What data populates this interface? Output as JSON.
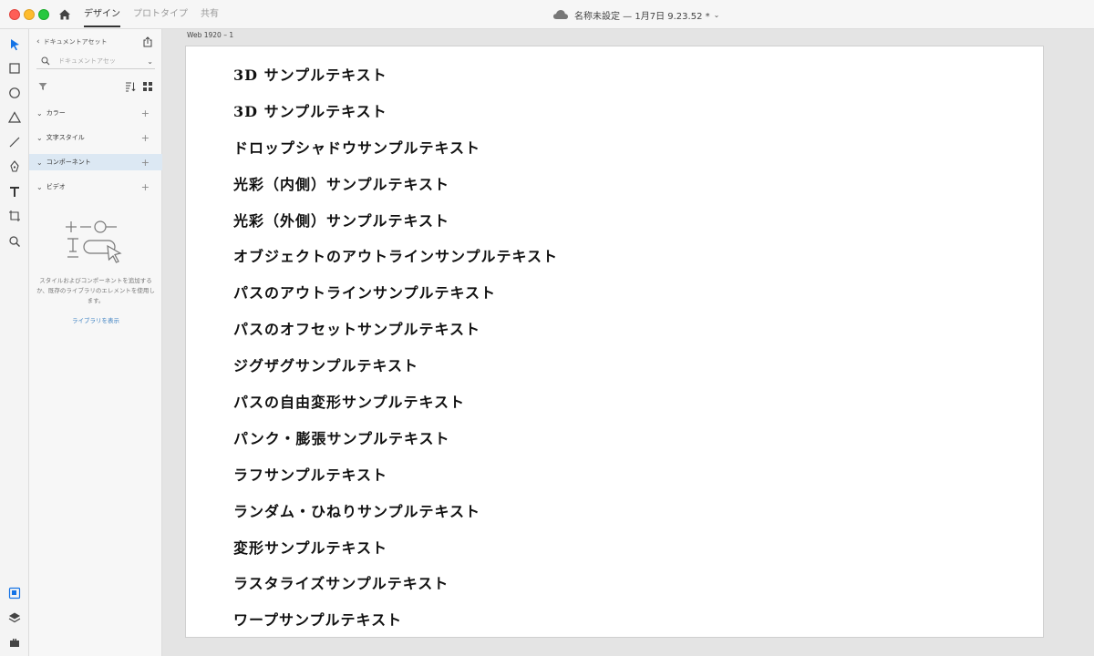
{
  "titlebar": {
    "tabs": [
      "デザイン",
      "プロトタイプ",
      "共有"
    ],
    "active_tab": 0,
    "document_title": "名称未設定 — 1月7日 9.23.52 *"
  },
  "assets_panel": {
    "header": "ドキュメントアセット",
    "search_placeholder": "ドキュメントアセッ",
    "sections": [
      "カラー",
      "文字スタイル",
      "コンポーネント",
      "ビデオ"
    ],
    "selected_section": 2,
    "empty_message": "スタイルおよびコンポーネントを追加するか、既存のライブラリのエレメントを使用します。",
    "library_link": "ライブラリを表示"
  },
  "canvas": {
    "artboard_label": "Web 1920 – 1",
    "samples": [
      "3D サンプルテキスト",
      "3D サンプルテキスト",
      "ドロップシャドウサンプルテキスト",
      "光彩（内側）サンプルテキスト",
      "光彩（外側）サンプルテキスト",
      "オブジェクトのアウトラインサンプルテキスト",
      "パスのアウトラインサンプルテキスト",
      "パスのオフセットサンプルテキスト",
      "ジグザグサンプルテキスト",
      "パスの自由変形サンプルテキスト",
      "パンク・膨張サンプルテキスト",
      "ラフサンプルテキスト",
      "ランダム・ひねりサンプルテキスト",
      "変形サンプルテキスト",
      "ラスタライズサンプルテキスト",
      "ワープサンプルテキスト"
    ]
  },
  "colors": {
    "accent": "#1473e6",
    "selected_row": "#dce8f3",
    "link": "#3a7fc1"
  }
}
